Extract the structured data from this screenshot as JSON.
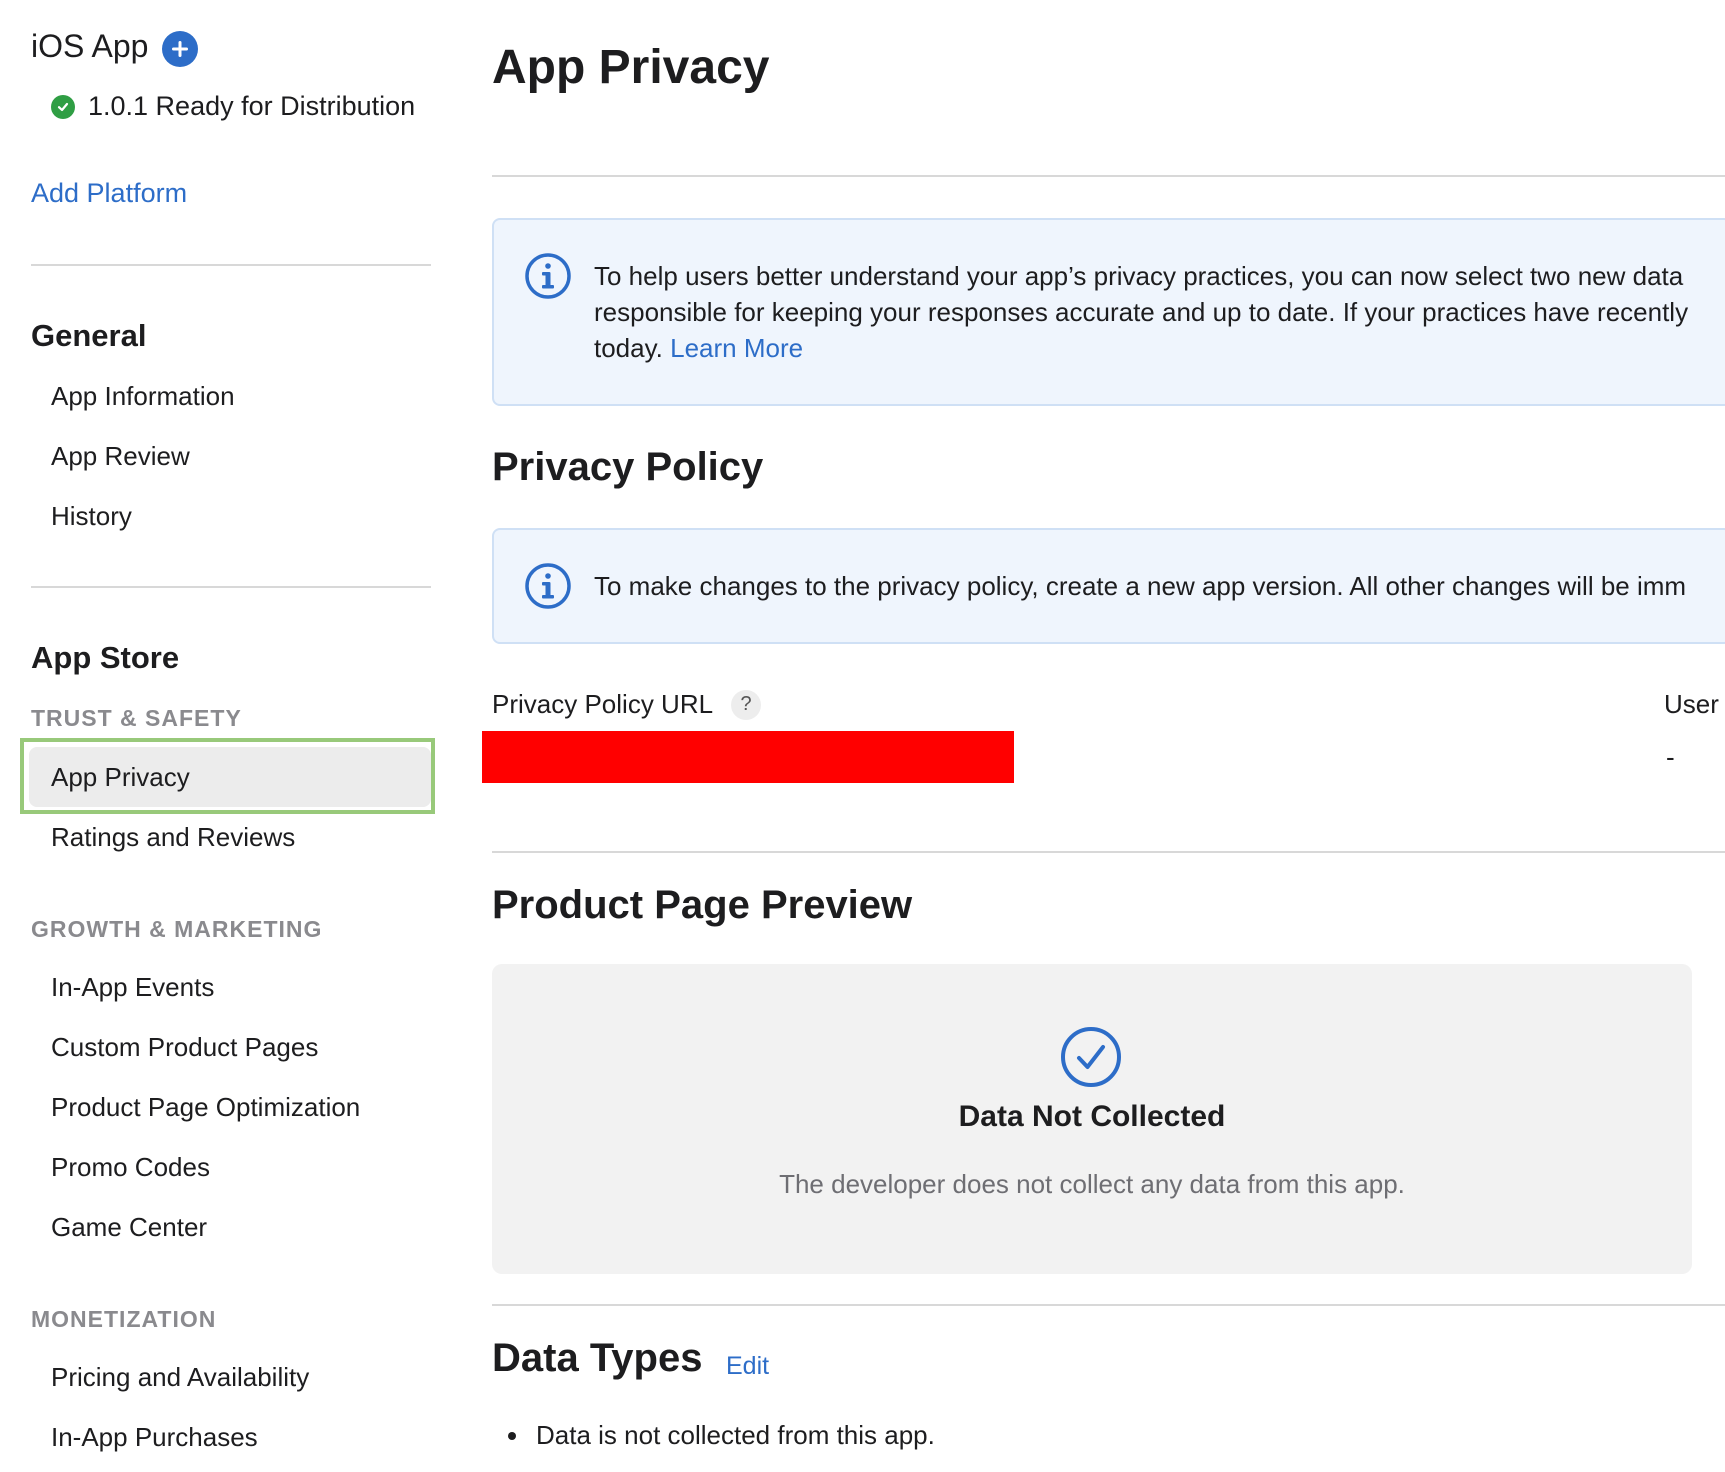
{
  "sidebar": {
    "platform": {
      "title": "iOS App",
      "version_status": "1.0.1 Ready for Distribution"
    },
    "add_platform": "Add Platform",
    "general": {
      "title": "General",
      "items": [
        "App Information",
        "App Review",
        "History"
      ]
    },
    "app_store": {
      "title": "App Store",
      "trust_safety": {
        "label": "TRUST & SAFETY",
        "items": [
          "App Privacy",
          "Ratings and Reviews"
        ]
      },
      "growth_marketing": {
        "label": "GROWTH & MARKETING",
        "items": [
          "In-App Events",
          "Custom Product Pages",
          "Product Page Optimization",
          "Promo Codes",
          "Game Center"
        ]
      },
      "monetization": {
        "label": "MONETIZATION",
        "items": [
          "Pricing and Availability",
          "In-App Purchases"
        ]
      }
    }
  },
  "main": {
    "title": "App Privacy",
    "info_banner": {
      "line1": "To help users better understand your app’s privacy practices, you can now select two new data",
      "line2": "responsible for keeping your responses accurate and up to date. If your practices have recently",
      "line3_prefix": "today. ",
      "learn_more": "Learn More"
    },
    "privacy_policy": {
      "title": "Privacy Policy",
      "notice": "To make changes to the privacy policy, create a new app version. All other changes will be imm",
      "url_label": "Privacy Policy URL",
      "help": "?",
      "user_label": "User",
      "user_value": "-"
    },
    "product_page_preview": {
      "title": "Product Page Preview",
      "status_title": "Data Not Collected",
      "status_desc": "The developer does not collect any data from this app."
    },
    "data_types": {
      "title": "Data Types",
      "edit": "Edit",
      "items": [
        "Data is not collected from this app."
      ]
    }
  },
  "colors": {
    "accent": "#2d6dc8",
    "success": "#2f9e44",
    "selection_outline": "#98c97a",
    "redaction": "#ff0000",
    "info_bg": "#eff5fd"
  }
}
